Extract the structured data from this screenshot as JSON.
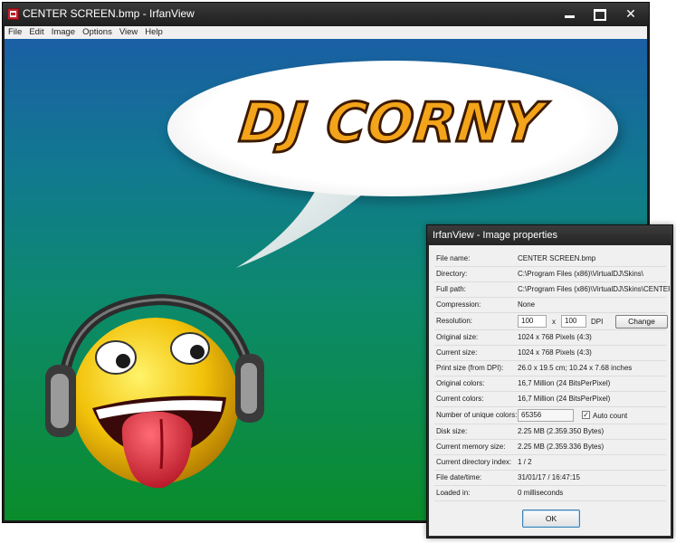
{
  "main_window": {
    "title": "CENTER SCREEN.bmp - IrfanView",
    "menu": [
      "File",
      "Edit",
      "Image",
      "Options",
      "View",
      "Help"
    ],
    "image_text": "DJ CORNY"
  },
  "properties_dialog": {
    "title": "IrfanView - Image properties",
    "rows": [
      {
        "label": "File name:",
        "value": "CENTER SCREEN.bmp"
      },
      {
        "label": "Directory:",
        "value": "C:\\Program Files (x86)\\VirtualDJ\\Skins\\"
      },
      {
        "label": "Full path:",
        "value": "C:\\Program Files (x86)\\VirtualDJ\\Skins\\CENTER"
      },
      {
        "label": "Compression:",
        "value": "None"
      },
      {
        "label": "Resolution:",
        "value": ""
      },
      {
        "label": "Original size:",
        "value": "1024 x 768  Pixels (4:3)"
      },
      {
        "label": "Current size:",
        "value": "1024 x 768  Pixels (4:3)"
      },
      {
        "label": "Print size (from DPI):",
        "value": "26.0 x 19.5 cm; 10.24 x 7.68 inches"
      },
      {
        "label": "Original colors:",
        "value": "16,7 Million   (24 BitsPerPixel)"
      },
      {
        "label": "Current colors:",
        "value": "16,7 Million   (24 BitsPerPixel)"
      },
      {
        "label": "Number of unique colors:",
        "value": ""
      },
      {
        "label": "Disk size:",
        "value": "2.25 MB (2.359.350 Bytes)"
      },
      {
        "label": "Current memory size:",
        "value": "2.25  MB (2.359.336 Bytes)"
      },
      {
        "label": "Current directory index:",
        "value": "1  /  2"
      },
      {
        "label": "File date/time:",
        "value": "31/01/17 / 16:47:15"
      },
      {
        "label": "Loaded in:",
        "value": "0 milliseconds"
      }
    ],
    "resolution": {
      "x": "100",
      "separator": "x",
      "y": "100",
      "unit": "DPI",
      "change_label": "Change"
    },
    "unique_colors": {
      "value": "65356",
      "auto_count_label": "Auto count",
      "auto_count_checked": true
    },
    "ok_label": "OK"
  }
}
